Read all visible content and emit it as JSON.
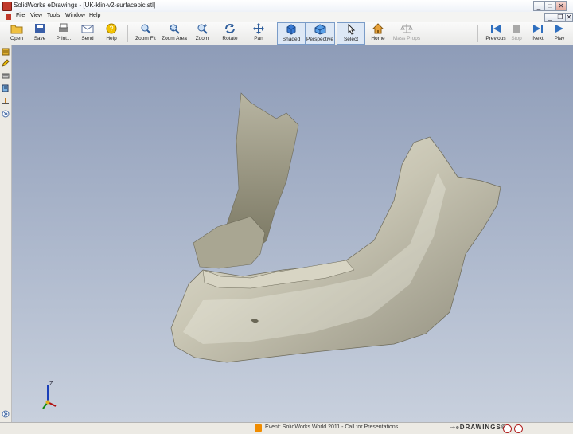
{
  "window": {
    "title": "SolidWorks eDrawings - [UK-klin-v2-surfacepic.stl]",
    "controls": {
      "minimize": "_",
      "maximize": "□",
      "close": "✕"
    },
    "doc_controls": {
      "minimize": "_",
      "restore": "❐",
      "close": "✕"
    }
  },
  "menu": [
    "File",
    "View",
    "Tools",
    "Window",
    "Help"
  ],
  "toolbar": {
    "open": "Open",
    "save": "Save",
    "print": "Print...",
    "send": "Send",
    "help": "Help",
    "zoom_fit": "Zoom Fit",
    "zoom_area": "Zoom Area",
    "zoom": "Zoom",
    "rotate": "Rotate",
    "pan": "Pan",
    "shaded": "Shaded",
    "perspective": "Perspective",
    "select": "Select",
    "home": "Home",
    "mass_props": "Mass Props",
    "previous": "Previous",
    "stop": "Stop",
    "next": "Next",
    "play": "Play"
  },
  "axis_label": "Z",
  "status": {
    "event": "Event: SolidWorks World 2011 - Call for Presentations",
    "brand": "DRAWINGS",
    "trademark": "®"
  },
  "colors": {
    "viewport_top": "#8e9cb8",
    "viewport_bottom": "#c8d0dd",
    "model": "#c9c6b4",
    "title_bar": "#eef2f8"
  },
  "icons": {
    "open": "folder-icon",
    "save": "floppy-icon",
    "print": "printer-icon",
    "send": "envelope-icon",
    "help": "question-icon",
    "zoom_fit": "magnifier-icon",
    "rotate": "rotate-arrows-icon",
    "pan": "move-arrows-icon",
    "shaded": "cube-shaded-icon",
    "perspective": "cube-perspective-icon",
    "select": "cursor-icon",
    "home": "house-icon",
    "mass_props": "scale-icon",
    "previous": "previous-icon",
    "stop": "stop-icon",
    "next": "next-icon",
    "play": "play-icon"
  }
}
